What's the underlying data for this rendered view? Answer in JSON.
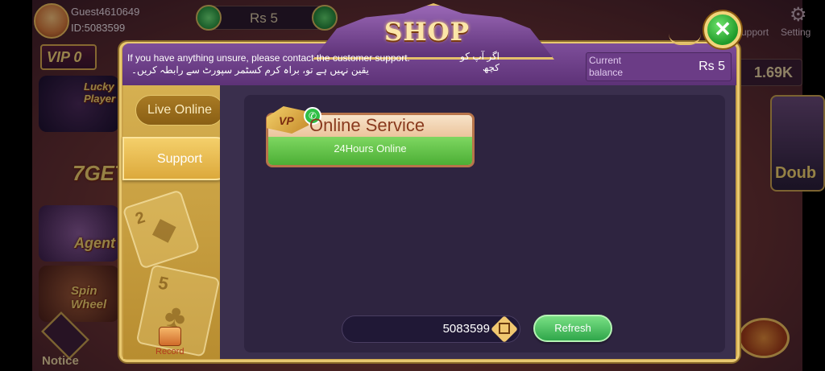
{
  "background": {
    "guest_name": "Guest4610649",
    "guest_id": "ID:5083599",
    "top_balance": "Rs  5",
    "vip_label": "VIP 0",
    "lucky_player": "Lucky Player",
    "agent_label": "Agent",
    "spin_wheel": "Spin Wheel",
    "notice_label": "Notice",
    "support_label": "Support",
    "setting_label": "Setting",
    "right_amount": "1.69K",
    "right_game_label": "Doub",
    "get_label": "7GET"
  },
  "shop": {
    "title": "SHOP",
    "notice_en": "If you have anything unsure, please contact the customer support.",
    "notice_ur_line1": "اگر آپ کو کچھ",
    "notice_ur_line2": "یقین نہیں ہے تو، براہ کرم کسٹمر سپورٹ سے رابطہ کریں۔",
    "balance_label": "Current balance",
    "balance_value": "Rs  5",
    "close_symbol": "✕"
  },
  "tabs": [
    {
      "label": "Live Online",
      "active": false
    },
    {
      "label": "Support",
      "active": true
    }
  ],
  "record": {
    "label": "Record"
  },
  "service": {
    "logo_text": "VP",
    "title": "Online Service",
    "subtitle": "24Hours Online"
  },
  "footer": {
    "user_id": "5083599",
    "refresh_label": "Refresh"
  },
  "colors": {
    "modal_gold": "#c9a148",
    "header_purple": "#6b3c86",
    "content_dark": "#2e2440",
    "green_button": "#2fa64a"
  }
}
